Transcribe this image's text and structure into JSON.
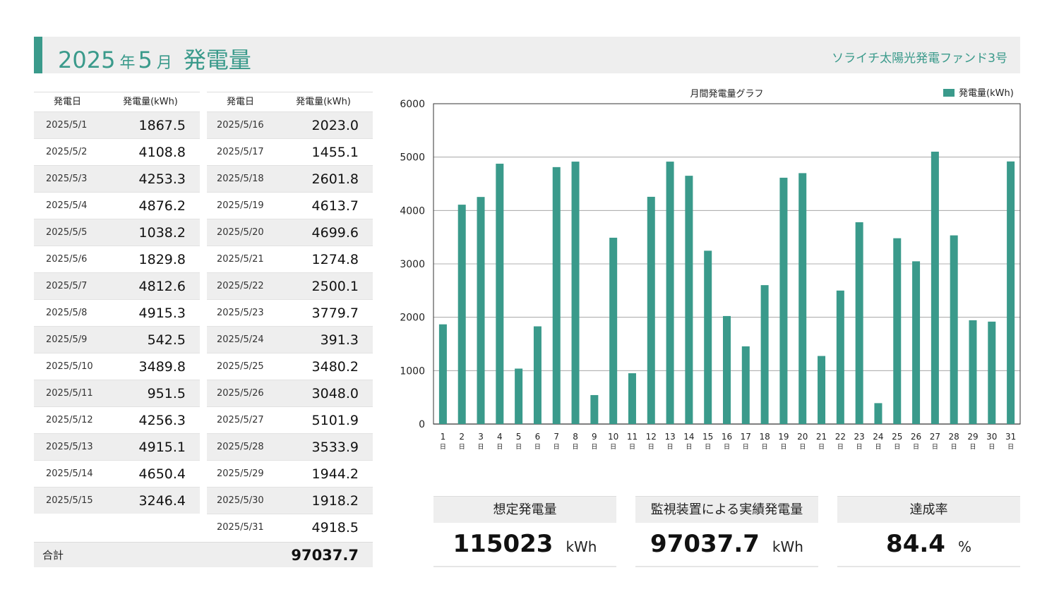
{
  "header": {
    "year": "2025",
    "year_suffix": "年",
    "month": "5",
    "month_suffix": "月",
    "heading": "発電量",
    "fund_name": "ソライチ太陽光発電ファンド3号"
  },
  "table": {
    "col_date": "発電日",
    "col_value": "発電量(kWh)",
    "left_rows": [
      {
        "date": "2025/5/1",
        "value": "1867.5"
      },
      {
        "date": "2025/5/2",
        "value": "4108.8"
      },
      {
        "date": "2025/5/3",
        "value": "4253.3"
      },
      {
        "date": "2025/5/4",
        "value": "4876.2"
      },
      {
        "date": "2025/5/5",
        "value": "1038.2"
      },
      {
        "date": "2025/5/6",
        "value": "1829.8"
      },
      {
        "date": "2025/5/7",
        "value": "4812.6"
      },
      {
        "date": "2025/5/8",
        "value": "4915.3"
      },
      {
        "date": "2025/5/9",
        "value": "542.5"
      },
      {
        "date": "2025/5/10",
        "value": "3489.8"
      },
      {
        "date": "2025/5/11",
        "value": "951.5"
      },
      {
        "date": "2025/5/12",
        "value": "4256.3"
      },
      {
        "date": "2025/5/13",
        "value": "4915.1"
      },
      {
        "date": "2025/5/14",
        "value": "4650.4"
      },
      {
        "date": "2025/5/15",
        "value": "3246.4"
      }
    ],
    "right_rows": [
      {
        "date": "2025/5/16",
        "value": "2023.0"
      },
      {
        "date": "2025/5/17",
        "value": "1455.1"
      },
      {
        "date": "2025/5/18",
        "value": "2601.8"
      },
      {
        "date": "2025/5/19",
        "value": "4613.7"
      },
      {
        "date": "2025/5/20",
        "value": "4699.6"
      },
      {
        "date": "2025/5/21",
        "value": "1274.8"
      },
      {
        "date": "2025/5/22",
        "value": "2500.1"
      },
      {
        "date": "2025/5/23",
        "value": "3779.7"
      },
      {
        "date": "2025/5/24",
        "value": "391.3"
      },
      {
        "date": "2025/5/25",
        "value": "3480.2"
      },
      {
        "date": "2025/5/26",
        "value": "3048.0"
      },
      {
        "date": "2025/5/27",
        "value": "5101.9"
      },
      {
        "date": "2025/5/28",
        "value": "3533.9"
      },
      {
        "date": "2025/5/29",
        "value": "1944.2"
      },
      {
        "date": "2025/5/30",
        "value": "1918.2"
      },
      {
        "date": "2025/5/31",
        "value": "4918.5"
      }
    ],
    "total_label": "合計",
    "total_value": "97037.7"
  },
  "chart_data": {
    "type": "bar",
    "title": "月間発電量グラフ",
    "series": [
      {
        "name": "発電量(kWh)",
        "values": [
          1867.5,
          4108.8,
          4253.3,
          4876.2,
          1038.2,
          1829.8,
          4812.6,
          4915.3,
          542.5,
          3489.8,
          951.5,
          4256.3,
          4915.1,
          4650.4,
          3246.4,
          2023.0,
          1455.1,
          2601.8,
          4613.7,
          4699.6,
          1274.8,
          2500.1,
          3779.7,
          391.3,
          3480.2,
          3048.0,
          5101.9,
          3533.9,
          1944.2,
          1918.2,
          4918.5
        ]
      }
    ],
    "categories": [
      "1",
      "2",
      "3",
      "4",
      "5",
      "6",
      "7",
      "8",
      "9",
      "10",
      "11",
      "12",
      "13",
      "14",
      "15",
      "16",
      "17",
      "18",
      "19",
      "20",
      "21",
      "22",
      "23",
      "24",
      "25",
      "26",
      "27",
      "28",
      "29",
      "30",
      "31"
    ],
    "category_suffix": "日",
    "ylim": [
      0,
      6000
    ],
    "yticks": [
      "0",
      "1000",
      "2000",
      "3000",
      "4000",
      "5000",
      "6000"
    ],
    "grid": true,
    "legend_position": "top-right",
    "bar_color": "#3a9a8b"
  },
  "summary": {
    "expected": {
      "label": "想定発電量",
      "value": "115023",
      "unit": "kWh"
    },
    "actual": {
      "label": "監視装置による実績発電量",
      "value": "97037.7",
      "unit": "kWh"
    },
    "rate": {
      "label": "達成率",
      "value": "84.4",
      "unit": "%"
    }
  }
}
